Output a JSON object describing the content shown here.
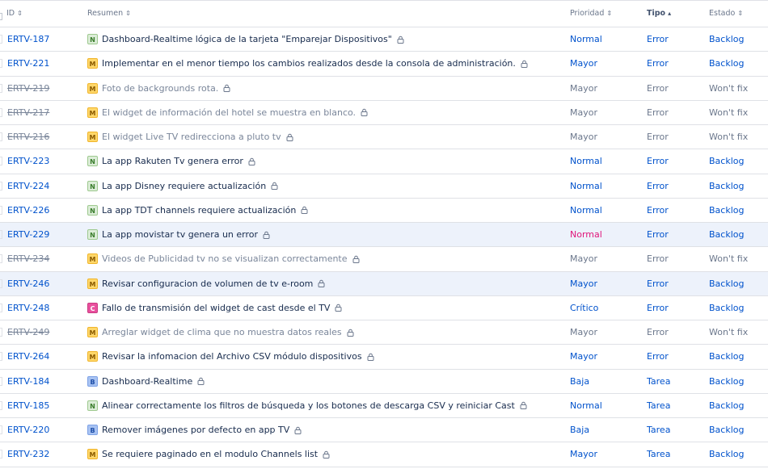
{
  "columns": {
    "id": "ID",
    "summary": "Resumen",
    "priority": "Prioridad",
    "type": "Tipo",
    "status": "Estado"
  },
  "sort_icons": {
    "neutral": "⇕",
    "ascending": "▴"
  },
  "colors": {
    "link": "#0052cc",
    "muted": "#6b778c",
    "highlight_row": "#edf2fb",
    "pink_priority": "#e0157a"
  },
  "rows": [
    {
      "key": "ERTV-187",
      "badge": "N",
      "summary": "Dashboard-Realtime lógica de la tarjeta \"Emparejar Dispositivos\"",
      "priority": "Normal",
      "type": "Error",
      "status": "Backlog"
    },
    {
      "key": "ERTV-221",
      "badge": "M",
      "summary": "Implementar en el menor tiempo los cambios realizados desde la consola de administración.",
      "priority": "Mayor",
      "type": "Error",
      "status": "Backlog"
    },
    {
      "key": "ERTV-219",
      "badge": "M",
      "summary": "Foto de backgrounds rota.",
      "priority": "Mayor",
      "type": "Error",
      "status": "Won't fix"
    },
    {
      "key": "ERTV-217",
      "badge": "M",
      "summary": "El widget de información del hotel se muestra en blanco.",
      "priority": "Mayor",
      "type": "Error",
      "status": "Won't fix"
    },
    {
      "key": "ERTV-216",
      "badge": "M",
      "summary": "El widget Live TV redirecciona a pluto tv",
      "priority": "Mayor",
      "type": "Error",
      "status": "Won't fix"
    },
    {
      "key": "ERTV-223",
      "badge": "N",
      "summary": "La app Rakuten Tv genera error",
      "priority": "Normal",
      "type": "Error",
      "status": "Backlog"
    },
    {
      "key": "ERTV-224",
      "badge": "N",
      "summary": "La app Disney requiere actualización",
      "priority": "Normal",
      "type": "Error",
      "status": "Backlog"
    },
    {
      "key": "ERTV-226",
      "badge": "N",
      "summary": "La app TDT channels requiere actualización",
      "priority": "Normal",
      "type": "Error",
      "status": "Backlog"
    },
    {
      "key": "ERTV-229",
      "badge": "N",
      "summary": "La app movistar tv genera un error",
      "priority": "Normal",
      "type": "Error",
      "status": "Backlog"
    },
    {
      "key": "ERTV-234",
      "badge": "M",
      "summary": "Videos de Publicidad tv no se visualizan correctamente",
      "priority": "Mayor",
      "type": "Error",
      "status": "Won't fix"
    },
    {
      "key": "ERTV-246",
      "badge": "M",
      "summary": "Revisar configuracion de volumen de tv e-room",
      "priority": "Mayor",
      "type": "Error",
      "status": "Backlog"
    },
    {
      "key": "ERTV-248",
      "badge": "C",
      "summary": "Fallo de transmisión del widget de cast desde el TV",
      "priority": "Crítico",
      "type": "Error",
      "status": "Backlog"
    },
    {
      "key": "ERTV-249",
      "badge": "M",
      "summary": "Arreglar widget de clima que no muestra datos reales",
      "priority": "Mayor",
      "type": "Error",
      "status": "Won't fix"
    },
    {
      "key": "ERTV-264",
      "badge": "M",
      "summary": "Revisar la infomacion del Archivo CSV módulo dispositivos",
      "priority": "Mayor",
      "type": "Error",
      "status": "Backlog"
    },
    {
      "key": "ERTV-184",
      "badge": "B",
      "summary": "Dashboard-Realtime",
      "priority": "Baja",
      "type": "Tarea",
      "status": "Backlog"
    },
    {
      "key": "ERTV-185",
      "badge": "N",
      "summary": "Alinear correctamente los filtros de búsqueda y los botones de descarga CSV y reiniciar Cast",
      "priority": "Normal",
      "type": "Tarea",
      "status": "Backlog"
    },
    {
      "key": "ERTV-220",
      "badge": "B",
      "summary": "Remover imágenes por defecto en app TV",
      "priority": "Baja",
      "type": "Tarea",
      "status": "Backlog"
    },
    {
      "key": "ERTV-232",
      "badge": "M",
      "summary": "Se requiere paginado en el modulo Channels list",
      "priority": "Mayor",
      "type": "Tarea",
      "status": "Backlog"
    }
  ]
}
